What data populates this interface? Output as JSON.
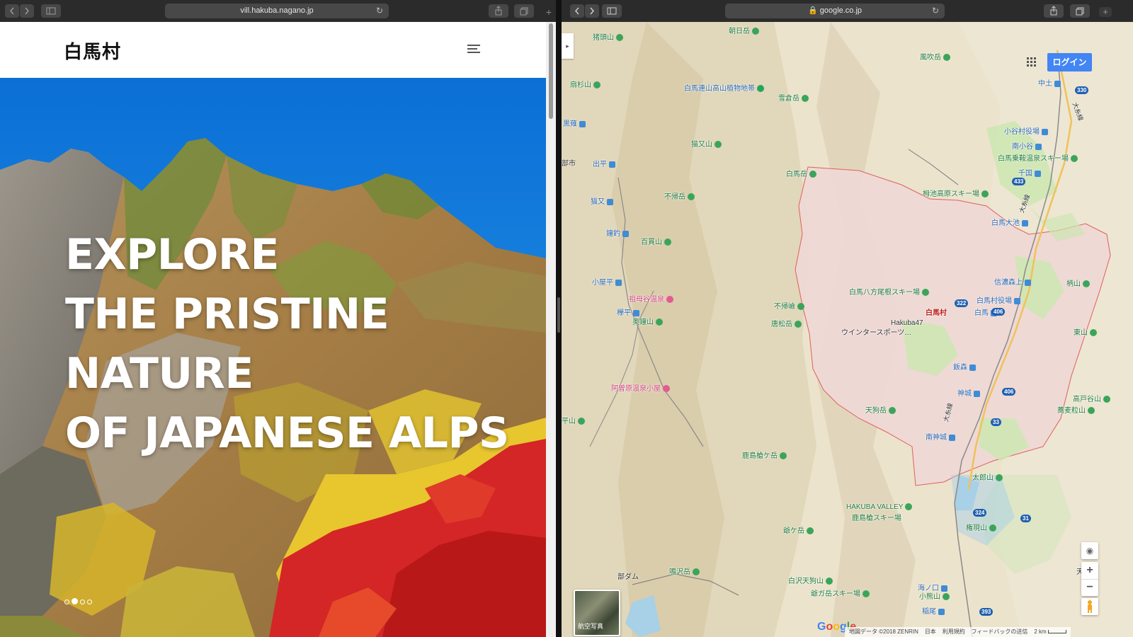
{
  "left_window": {
    "url": "vill.hakuba.nagano.jp",
    "site_logo": "白馬村",
    "hero_lines": [
      "EXPLORE",
      "THE PRISTINE NATURE",
      "OF JAPANESE ALPS"
    ],
    "carousel": {
      "count": 4,
      "active_index": 1
    }
  },
  "right_window": {
    "url": "google.co.jp",
    "login_label": "ログイン",
    "aerial_label": "航空写真",
    "google_logo": "Google",
    "footer": [
      "地図データ ©2018 ZENRIN",
      "日本",
      "利用規約",
      "フィードバックの送信",
      "2 km"
    ],
    "labels": [
      {
        "text": "猪頭山",
        "pin": "m"
      },
      {
        "text": "朝日岳",
        "pin": "m"
      },
      {
        "text": "風吹岳",
        "pin": "m"
      },
      {
        "text": "扇杉山",
        "pin": "m"
      },
      {
        "text": "白馬連山高山植物地帯",
        "pin": "g"
      },
      {
        "text": "雪倉岳",
        "pin": "m"
      },
      {
        "text": "中土",
        "pin": "b"
      },
      {
        "text": "黒薙",
        "pin": "b"
      },
      {
        "text": "小谷村役場",
        "pin": "b"
      },
      {
        "text": "猫又山",
        "pin": "m"
      },
      {
        "text": "南小谷",
        "pin": "b"
      },
      {
        "text": "白馬乗鞍温泉スキー場",
        "pin": "m"
      },
      {
        "text": "部市",
        "pin": ""
      },
      {
        "text": "出平",
        "pin": "b"
      },
      {
        "text": "千国",
        "pin": "b"
      },
      {
        "text": "白馬岳",
        "pin": "m"
      },
      {
        "text": "不帰岳",
        "pin": "m"
      },
      {
        "text": "栂池高原スキー場",
        "pin": "m"
      },
      {
        "text": "猫又",
        "pin": "b"
      },
      {
        "text": "白馬大池",
        "pin": "b"
      },
      {
        "text": "鐘釣",
        "pin": "b"
      },
      {
        "text": "百貫山",
        "pin": "m"
      },
      {
        "text": "信濃森上",
        "pin": "b"
      },
      {
        "text": "小屋平",
        "pin": "b"
      },
      {
        "text": "柄山",
        "pin": "m"
      },
      {
        "text": "祖母谷温泉",
        "pin": "p"
      },
      {
        "text": "白馬八方尾根スキー場",
        "pin": "m"
      },
      {
        "text": "白馬村役場",
        "pin": "b"
      },
      {
        "text": "不帰嶮",
        "pin": "m"
      },
      {
        "text": "欅平",
        "pin": "b"
      },
      {
        "text": "白馬村",
        "pin": ""
      },
      {
        "text": "白馬",
        "pin": "b"
      },
      {
        "text": "奥鐘山",
        "pin": "m"
      },
      {
        "text": "唐松岳",
        "pin": "m"
      },
      {
        "text": "Hakuba47",
        "pin": ""
      },
      {
        "text": "ウインタースポーツ…",
        "pin": ""
      },
      {
        "text": "東山",
        "pin": "m"
      },
      {
        "text": "飯森",
        "pin": "b"
      },
      {
        "text": "阿曽原温泉小屋",
        "pin": "p"
      },
      {
        "text": "神城",
        "pin": "b"
      },
      {
        "text": "高戸谷山",
        "pin": "m"
      },
      {
        "text": "天狗岳",
        "pin": "m"
      },
      {
        "text": "蕎麦粒山",
        "pin": "m"
      },
      {
        "text": "平山",
        "pin": "m"
      },
      {
        "text": "南神城",
        "pin": "b"
      },
      {
        "text": "鹿島槍ケ岳",
        "pin": "m"
      },
      {
        "text": "太郎山",
        "pin": "m"
      },
      {
        "text": "HAKUBA VALLEY",
        "pin": "m"
      },
      {
        "text": "鹿島槍スキー場",
        "pin": ""
      },
      {
        "text": "権現山",
        "pin": "m"
      },
      {
        "text": "爺ケ岳",
        "pin": "m"
      },
      {
        "text": "部ダム",
        "pin": ""
      },
      {
        "text": "鳴沢岳",
        "pin": "m"
      },
      {
        "text": "天",
        "pin": ""
      },
      {
        "text": "白沢天狗山",
        "pin": "m"
      },
      {
        "text": "海ノ口",
        "pin": "b"
      },
      {
        "text": "爺ガ岳スキー場",
        "pin": "m"
      },
      {
        "text": "小熊山",
        "pin": "m"
      },
      {
        "text": "稲尾",
        "pin": "b"
      }
    ],
    "road_shields": [
      "330",
      "433",
      "322",
      "406",
      "406",
      "33",
      "324",
      "31",
      "393"
    ],
    "road_names": [
      "大糸線",
      "大糸線",
      "大糸線"
    ],
    "colors": {
      "map_bg": "#ede4cf",
      "village_fill": "#efd9d6",
      "border": "#e05858",
      "accent": "#4285f4",
      "green": "#cde6b2"
    }
  }
}
